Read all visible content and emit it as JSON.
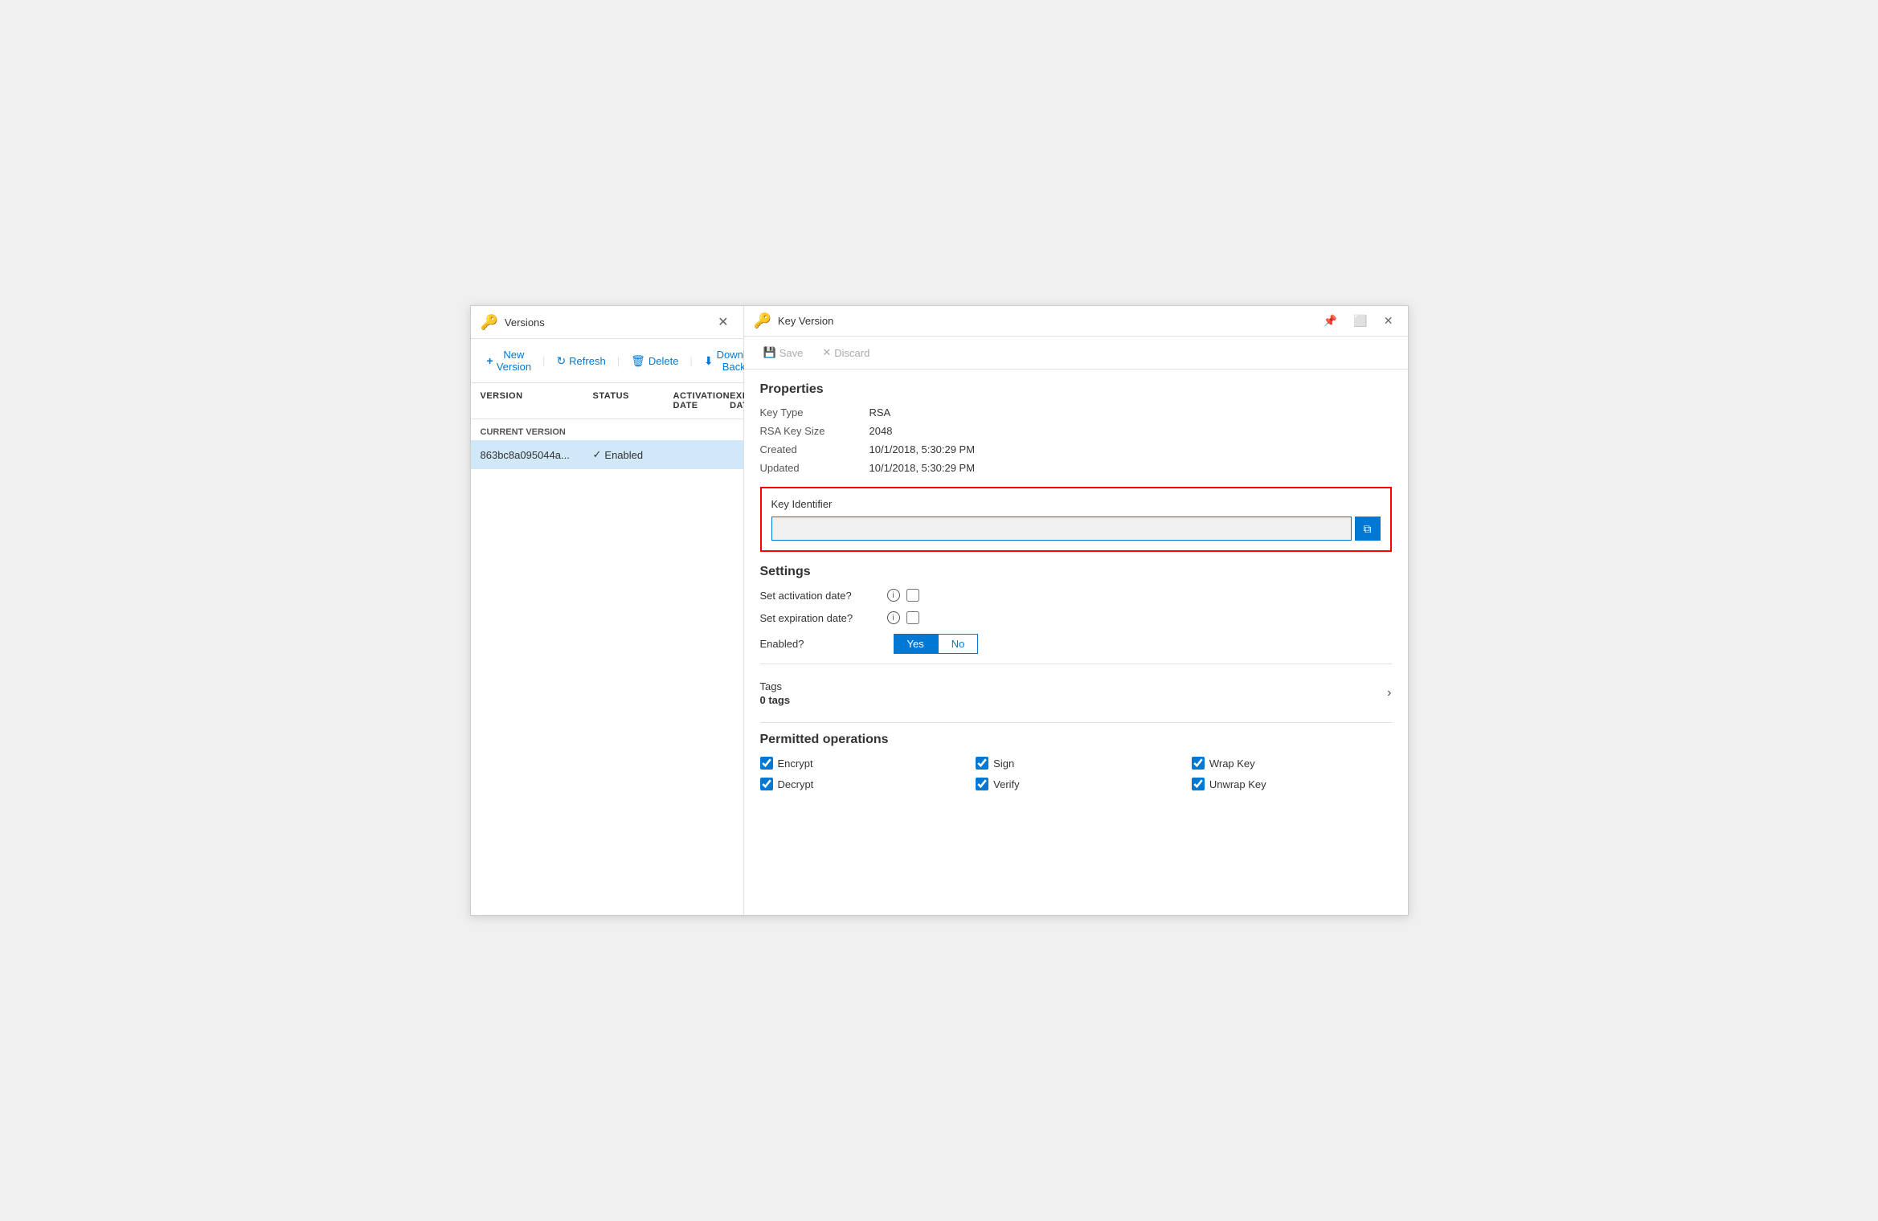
{
  "leftPanel": {
    "title": "Versions",
    "keyIconSymbol": "🔑",
    "toolbar": {
      "newVersion": "New Version",
      "refresh": "Refresh",
      "delete": "Delete",
      "downloadBackup": "Download Backup"
    },
    "tableHeaders": {
      "version": "VERSION",
      "status": "STATUS",
      "activationDate": "ACTIVATION DATE",
      "expirationDate": "EXPIRATION DATE"
    },
    "sectionLabel": "CURRENT VERSION",
    "rows": [
      {
        "keyId": "863bc8a095044a...",
        "status": "Enabled",
        "activationDate": "",
        "expirationDate": ""
      }
    ]
  },
  "rightPanel": {
    "title": "Key Version",
    "keyIconSymbol": "🔑",
    "toolbar": {
      "save": "Save",
      "discard": "Discard"
    },
    "properties": {
      "heading": "Properties",
      "keyType": {
        "label": "Key Type",
        "value": "RSA"
      },
      "rsaKeySize": {
        "label": "RSA Key Size",
        "value": "2048"
      },
      "created": {
        "label": "Created",
        "value": "10/1/2018, 5:30:29 PM"
      },
      "updated": {
        "label": "Updated",
        "value": "10/1/2018, 5:30:29 PM"
      }
    },
    "keyIdentifier": {
      "label": "Key Identifier",
      "value": "",
      "placeholder": ""
    },
    "settings": {
      "heading": "Settings",
      "activationDate": {
        "label": "Set activation date?",
        "checked": false
      },
      "expirationDate": {
        "label": "Set expiration date?",
        "checked": false
      },
      "enabled": {
        "label": "Enabled?",
        "yes": "Yes",
        "no": "No",
        "activeValue": "yes"
      }
    },
    "tags": {
      "label": "Tags",
      "count": "0 tags"
    },
    "permittedOps": {
      "heading": "Permitted operations",
      "ops": [
        {
          "label": "Encrypt",
          "checked": true
        },
        {
          "label": "Sign",
          "checked": true
        },
        {
          "label": "Wrap Key",
          "checked": true
        },
        {
          "label": "Decrypt",
          "checked": true
        },
        {
          "label": "Verify",
          "checked": true
        },
        {
          "label": "Unwrap Key",
          "checked": true
        }
      ]
    }
  }
}
